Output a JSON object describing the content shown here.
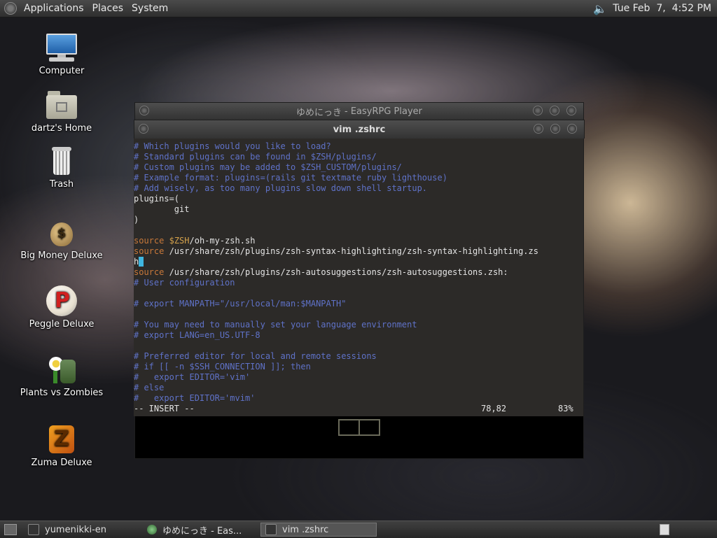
{
  "top_panel": {
    "menus": [
      "Applications",
      "Places",
      "System"
    ],
    "clock": "Tue Feb  7,  4:52 PM"
  },
  "desktop_icons": [
    {
      "label": "Computer"
    },
    {
      "label": "dartz's Home"
    },
    {
      "label": "Trash"
    },
    {
      "label": "Big Money Deluxe"
    },
    {
      "label": "Peggle Deluxe"
    },
    {
      "label": "Plants vs Zombies"
    },
    {
      "label": "Zuma Deluxe"
    }
  ],
  "back_window": {
    "title": "- EasyRPG Player",
    "title_prefix": "ゆめにっき"
  },
  "vim_window": {
    "title": "vim .zshrc",
    "lines": [
      [
        {
          "c": "cm",
          "t": "# Which plugins would you like to load?"
        }
      ],
      [
        {
          "c": "cm",
          "t": "# Standard plugins can be found in $ZSH/plugins/"
        }
      ],
      [
        {
          "c": "cm",
          "t": "# Custom plugins may be added to $ZSH_CUSTOM/plugins/"
        }
      ],
      [
        {
          "c": "cm",
          "t": "# Example format: plugins=(rails git textmate ruby lighthouse)"
        }
      ],
      [
        {
          "c": "cm",
          "t": "# Add wisely, as too many plugins slow down shell startup."
        }
      ],
      [
        {
          "c": "",
          "t": "plugins=("
        }
      ],
      [
        {
          "c": "",
          "t": "        git"
        }
      ],
      [
        {
          "c": "",
          "t": ")"
        }
      ],
      [
        {
          "c": "",
          "t": " "
        }
      ],
      [
        {
          "c": "kw",
          "t": "source"
        },
        {
          "c": "",
          "t": " "
        },
        {
          "c": "var",
          "t": "$ZSH"
        },
        {
          "c": "",
          "t": "/oh-my-zsh.sh"
        }
      ],
      [
        {
          "c": "kw",
          "t": "source"
        },
        {
          "c": "",
          "t": " /usr/share/zsh/plugins/zsh-syntax-highlighting/zsh-syntax-highlighting.zs"
        }
      ],
      [
        {
          "c": "",
          "t": "h"
        },
        {
          "c": "cursor",
          "t": " "
        }
      ],
      [
        {
          "c": "kw",
          "t": "source"
        },
        {
          "c": "",
          "t": " /usr/share/zsh/plugins/zsh-autosuggestions/zsh-autosuggestions.zsh:"
        }
      ],
      [
        {
          "c": "cm",
          "t": "# User configuration"
        }
      ],
      [
        {
          "c": "",
          "t": " "
        }
      ],
      [
        {
          "c": "cm",
          "t": "# export MANPATH=\"/usr/local/man:$MANPATH\""
        }
      ],
      [
        {
          "c": "",
          "t": " "
        }
      ],
      [
        {
          "c": "cm",
          "t": "# You may need to manually set your language environment"
        }
      ],
      [
        {
          "c": "cm",
          "t": "# export LANG=en_US.UTF-8"
        }
      ],
      [
        {
          "c": "",
          "t": " "
        }
      ],
      [
        {
          "c": "cm",
          "t": "# Preferred editor for local and remote sessions"
        }
      ],
      [
        {
          "c": "cm",
          "t": "# if [[ -n $SSH_CONNECTION ]]; then"
        }
      ],
      [
        {
          "c": "cm",
          "t": "#   export EDITOR='vim'"
        }
      ],
      [
        {
          "c": "cm",
          "t": "# else"
        }
      ],
      [
        {
          "c": "cm",
          "t": "#   export EDITOR='mvim'"
        }
      ]
    ],
    "status": {
      "mode": "-- INSERT --",
      "position": "78,82",
      "percent": "83%"
    }
  },
  "taskbar": {
    "tasks": [
      {
        "label": "yumenikki-en",
        "active": false
      },
      {
        "label": "ゆめにっき - Eas...",
        "active": false
      },
      {
        "label": "vim .zshrc",
        "active": true
      }
    ]
  }
}
